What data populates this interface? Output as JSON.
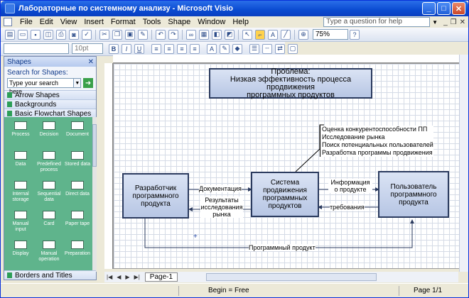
{
  "window": {
    "title": "Лабораторные по системному анализу - Microsoft Visio"
  },
  "menu": {
    "items": [
      "File",
      "Edit",
      "View",
      "Insert",
      "Format",
      "Tools",
      "Shape",
      "Window",
      "Help"
    ],
    "ask_placeholder": "Type a question for help"
  },
  "toolbar": {
    "zoom": "75%",
    "font_size": "10pt"
  },
  "shapes": {
    "title": "Shapes",
    "search_label": "Search for Shapes:",
    "search_placeholder": "Type your search here",
    "stencils": [
      "Arrow Shapes",
      "Backgrounds",
      "Basic Flowchart Shapes"
    ],
    "items": [
      [
        "Process",
        "Decision",
        "Document"
      ],
      [
        "Data",
        "Predefined process",
        "Stored data"
      ],
      [
        "Internal storage",
        "Sequential data",
        "Direct data"
      ],
      [
        "Manual input",
        "Card",
        "Paper tape"
      ],
      [
        "Display",
        "Manual operation",
        "Preparation"
      ]
    ],
    "bottom_stencil": "Borders and Titles"
  },
  "diagram": {
    "problem": [
      "Проблема:",
      "Низкая эффективность процесса продвижения",
      "программных продуктов"
    ],
    "annotations": [
      "Оценка конкурентоспособности ПП",
      "Исследование рынка",
      "Поиск потенциальных пользователей",
      "Разработка программы продвижения"
    ],
    "developer": [
      "Разработчик",
      "программного",
      "продукта"
    ],
    "system": [
      "Система",
      "продвижения",
      "программных",
      "продуктов"
    ],
    "user": [
      "Пользователь",
      "программного",
      "продукта"
    ],
    "labels": {
      "docs": "Документация",
      "results": [
        "Результаты",
        "исследования",
        "рынка"
      ],
      "info": [
        "Информация",
        "о продукте"
      ],
      "requirements": "требования",
      "product": "Программный продукт"
    }
  },
  "pages": {
    "tab": "Page-1"
  },
  "status": {
    "left": "Begin = Free",
    "right": "Page 1/1"
  }
}
